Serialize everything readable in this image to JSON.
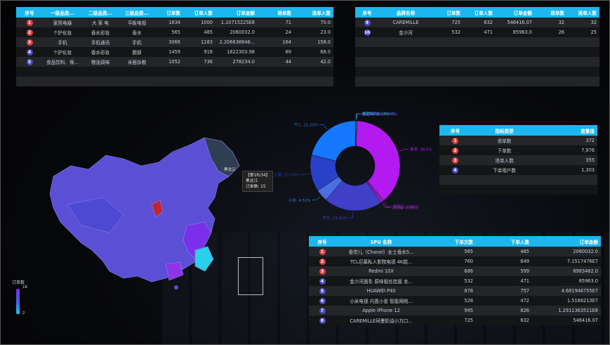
{
  "table1": {
    "headers": [
      "序号",
      "一级品类...",
      "二级品类...",
      "三级品类...",
      "订单数",
      "订单人数",
      "订单金额",
      "退单数",
      "退单人数"
    ],
    "rows": [
      [
        "1",
        "家用电器",
        "大 家 电",
        "平板电视",
        "1834",
        "1000",
        "1.10715225E8",
        "71",
        "70.0"
      ],
      [
        "2",
        "个护化妆",
        "香水彩妆",
        "香水",
        "565",
        "485",
        "2060032.0",
        "24",
        "23.0"
      ],
      [
        "3",
        "手机",
        "手机通讯",
        "手机",
        "3066",
        "1183",
        "2.206638846...",
        "164",
        "158.0"
      ],
      [
        "4",
        "个护化妆",
        "香水彩妆",
        "腮部",
        "1459",
        "918",
        "1622303.98",
        "69",
        "68.0"
      ],
      [
        "5",
        "食品饮料、保...",
        "粮油调味",
        "米面杂粮",
        "1052",
        "736",
        "278234.0",
        "44",
        "42.0"
      ]
    ]
  },
  "table2": {
    "headers": [
      "序号",
      "品牌名称",
      "订单数",
      "订单人数",
      "订单金额",
      "退单数",
      "退单人数"
    ],
    "rows": [
      [
        "9",
        "CAREMiLLE",
        "725",
        "632",
        "546416.07",
        "32",
        "32"
      ],
      [
        "10",
        "金沙河",
        "532",
        "471",
        "85963.0",
        "26",
        "25"
      ]
    ]
  },
  "table3": {
    "headers": [
      "序号",
      "指标类型",
      "度量值"
    ],
    "rows": [
      [
        "1",
        "退单数",
        "372"
      ],
      [
        "2",
        "下单数",
        "7,976"
      ],
      [
        "3",
        "退单人数",
        "355"
      ],
      [
        "4",
        "下单用户数",
        "1,303"
      ]
    ]
  },
  "table4": {
    "headers": [
      "序号",
      "SPU 名称",
      "下单次数",
      "下单人数",
      "订单金额"
    ],
    "rows": [
      [
        "1",
        "香奈儿（Chanel）女士香水5...",
        "565",
        "485",
        "2060032.0"
      ],
      [
        "2",
        "TCL巨幕私人影院电视 4K超...",
        "760",
        "649",
        "7.1517476E7"
      ],
      [
        "3",
        "Redmi 10X",
        "686",
        "599",
        "8983482.0"
      ],
      [
        "4",
        "金沙河面条 原味银丝挂面 龙...",
        "532",
        "471",
        "85963.0"
      ],
      [
        "5",
        "HUAWEI P40",
        "878",
        "757",
        "4.681946755E7"
      ],
      [
        "6",
        "小米电视 内置小爱 智能网络...",
        "528",
        "472",
        "1.5166213E7"
      ],
      [
        "7",
        "Apple iPhone 12",
        "995",
        "826",
        "1.2911363511E8"
      ],
      [
        "8",
        "CAREMiLLE珂曼奶油小方口...",
        "725",
        "632",
        "546416.07"
      ]
    ]
  },
  "map": {
    "legend_title": "订单数",
    "legend_max": "16",
    "legend_min": "2",
    "region_label": "黑龙江",
    "tooltip_line1": "【第1R/34】",
    "tooltip_line2": "黑龙江",
    "tooltip_line3": "订单数: 15"
  },
  "chart_data": {
    "type": "pie",
    "variant": "donut",
    "slices": [
      {
        "label": "金沙河面条: 0.03%",
        "value": 0.03,
        "color": "#3a7bd5"
      },
      {
        "label": "索尼MI: 0.32%",
        "value": 0.32,
        "color": "#1ec8e6"
      },
      {
        "label": "香奈: 38.5%",
        "value": 38.5,
        "color": "#b31af0"
      },
      {
        "label": "香奈儿: 0.61%",
        "value": 0.61,
        "color": "#8a2be2"
      },
      {
        "label": "小红帽: 0.56%",
        "value": 0.56,
        "color": "#d020d0"
      },
      {
        "label": "华为: 21.12%",
        "value": 21.12,
        "color": "#3f3fc8"
      },
      {
        "label": "小米: 4.52%",
        "value": 4.52,
        "color": "#4a6fe0"
      },
      {
        "label": "三星: 13.14%",
        "value": 13.14,
        "color": "#2a40c8"
      },
      {
        "label": "TCL: 21.33%",
        "value": 21.33,
        "color": "#1677ff"
      },
      {
        "label": "CAREMiLLE: 0.16%",
        "value": 0.16,
        "color": "#6a5acd"
      }
    ]
  }
}
